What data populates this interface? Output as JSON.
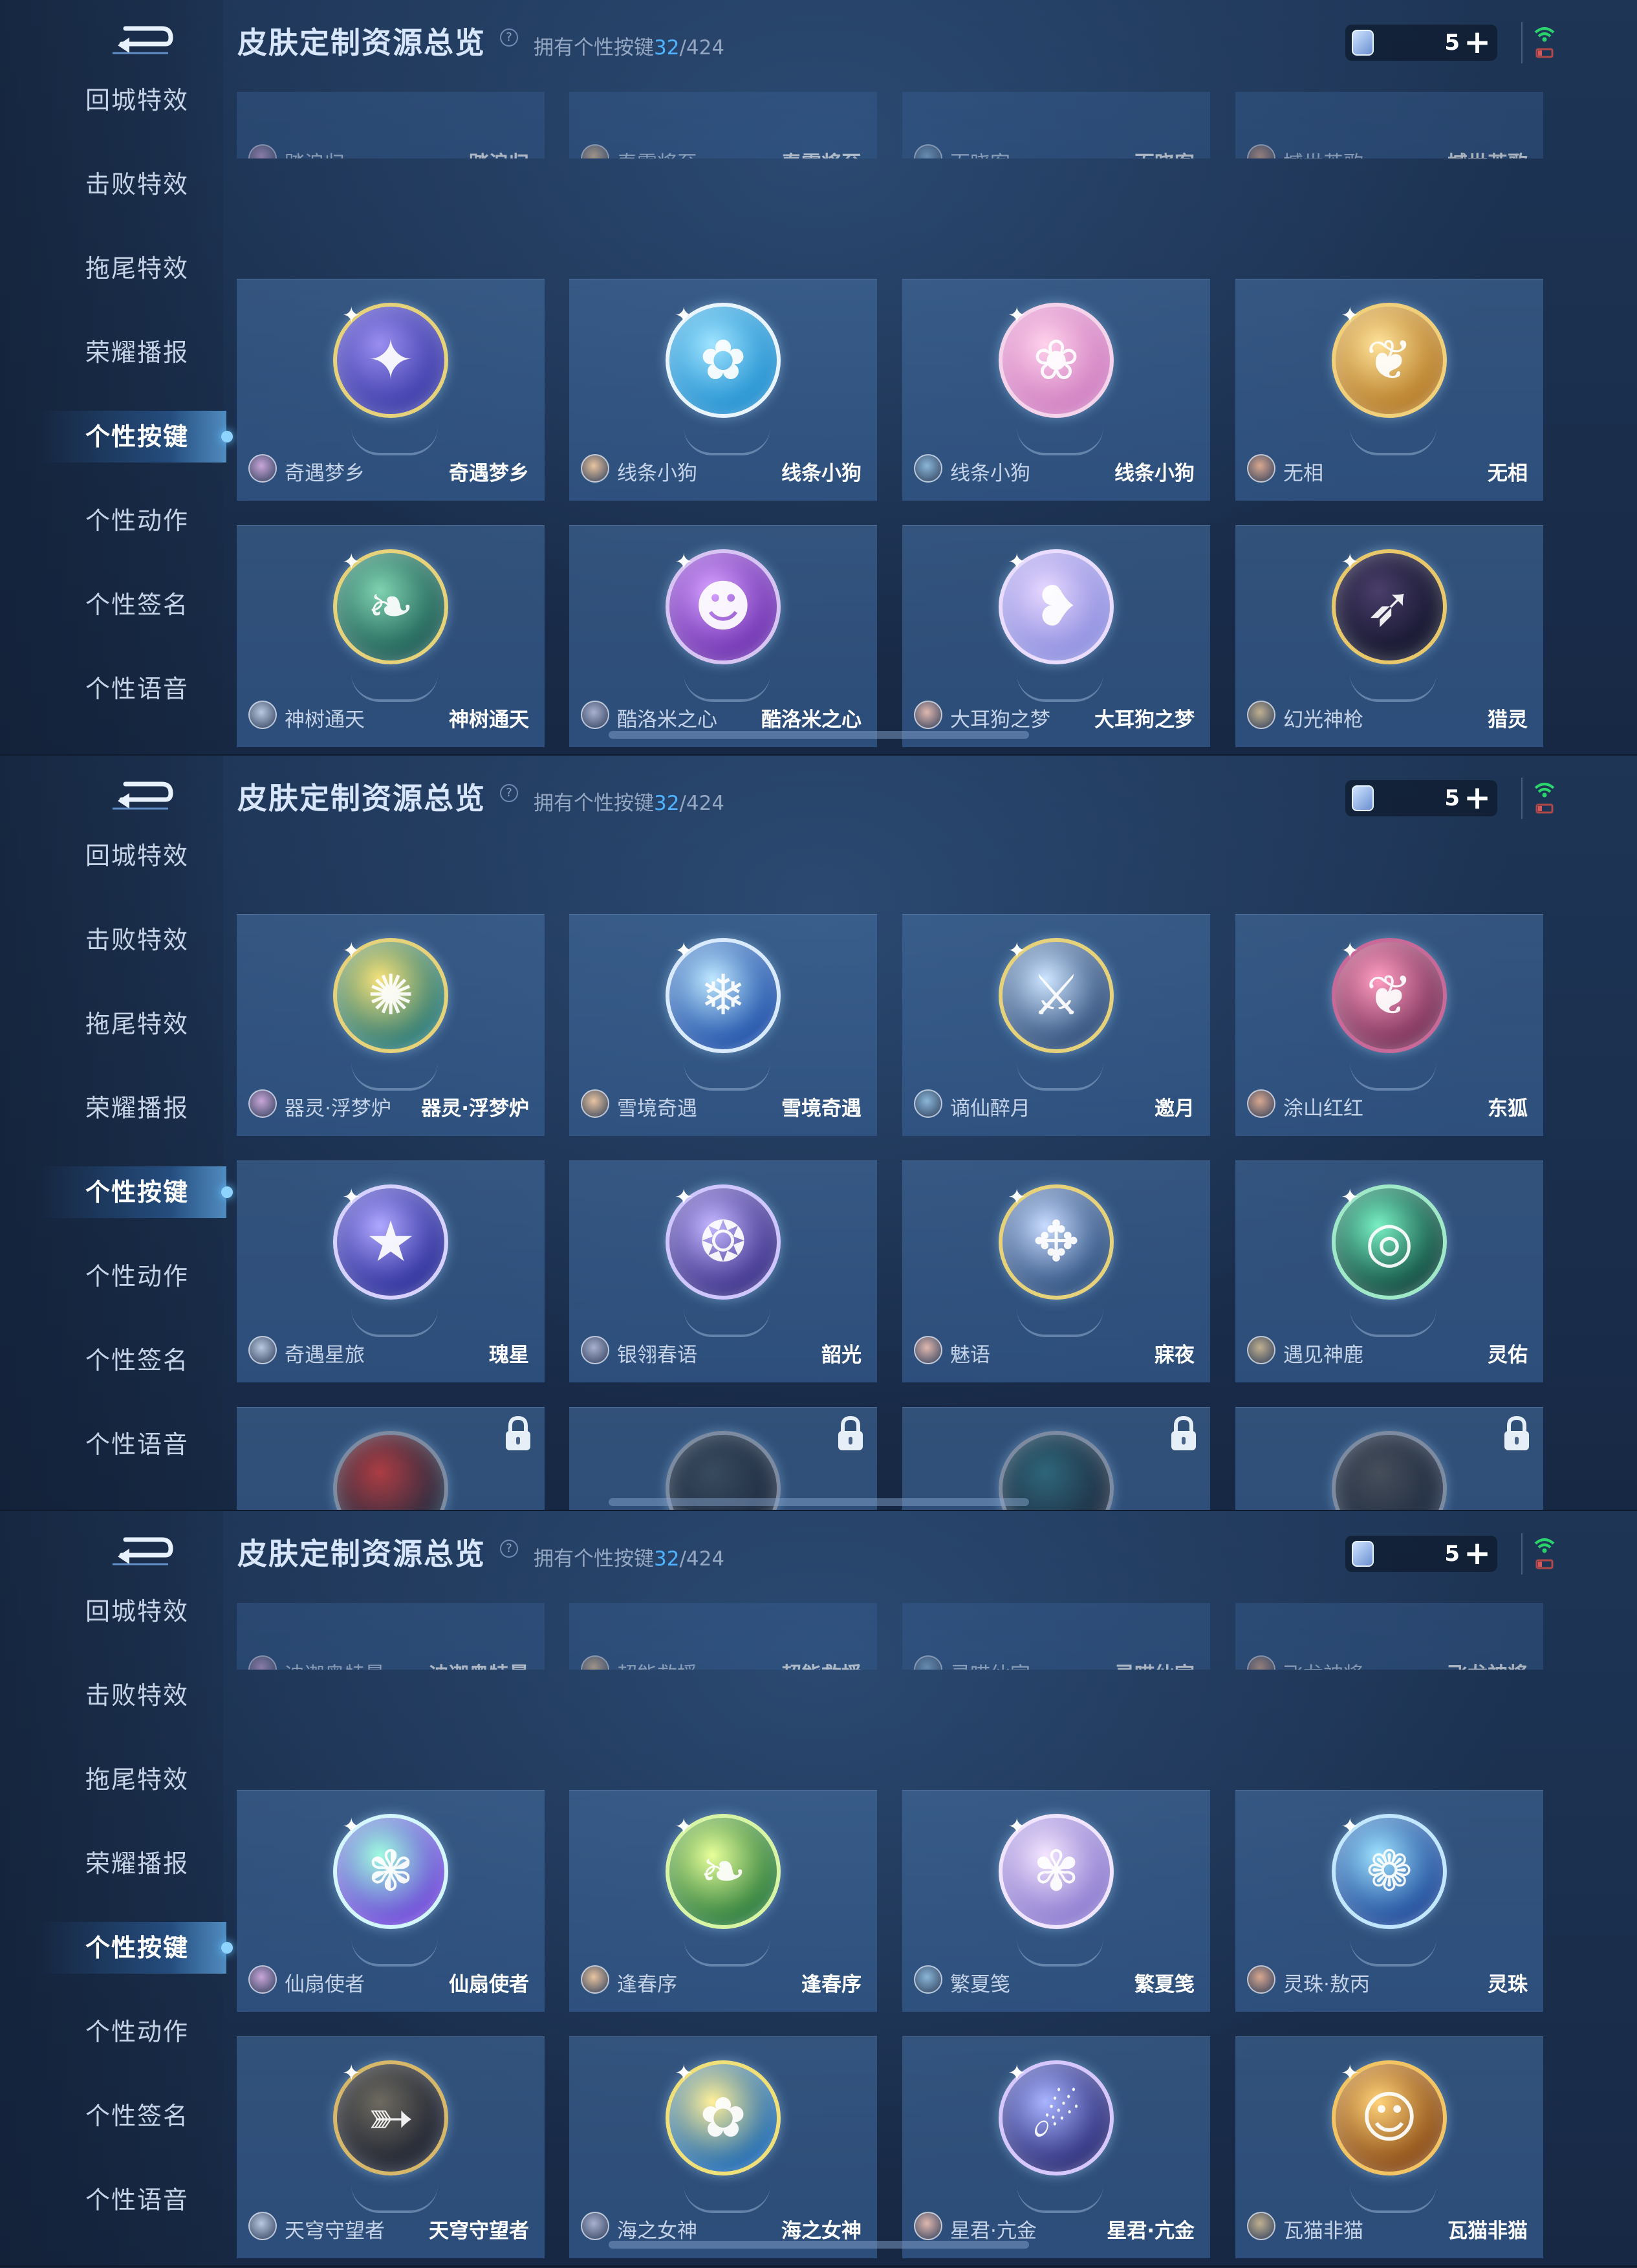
{
  "title": "皮肤定制资源总览",
  "owned_prefix": "拥有个性按键",
  "owned_count": "32",
  "owned_total": "/424",
  "currency_amount": "5",
  "plus_label": "+",
  "help_label": "?",
  "nav": [
    "回城特效",
    "击败特效",
    "拖尾特效",
    "荣耀播报",
    "个性按键",
    "个性动作",
    "个性签名",
    "个性语音"
  ],
  "active_nav_index": 4,
  "colors": {
    "accent": "#4fb4ff",
    "active_nav": "#ffffff",
    "card": "#3a6291",
    "signal": "#2bd56b"
  },
  "icons": {
    "back": "back-arrow-icon",
    "help": "question-icon",
    "currency": "coupon-icon",
    "signal": "wifi-signal-icon",
    "lock": "lock-icon"
  },
  "panels": [
    {
      "partial_row": [
        {
          "hero": "踏浪归",
          "skin": "踏浪归"
        },
        {
          "hero": "春霖将至",
          "skin": "春霖将至"
        },
        {
          "hero": "百晓客",
          "skin": "百晓客"
        },
        {
          "hero": "撼世英歌",
          "skin": "撼世英歌"
        }
      ],
      "rows": [
        [
          {
            "hero": "奇遇梦乡",
            "skin": "奇遇梦乡",
            "icon": "dream-cat-icon"
          },
          {
            "hero": "线条小狗",
            "skin": "线条小狗",
            "icon": "line-puppy-icon"
          },
          {
            "hero": "线条小狗",
            "skin": "线条小狗",
            "icon": "line-puppy-icon"
          },
          {
            "hero": "无相",
            "skin": "无相",
            "icon": "feather-blade-icon"
          }
        ],
        [
          {
            "hero": "神树通天",
            "skin": "神树通天",
            "icon": "golden-leaf-icon"
          },
          {
            "hero": "酷洛米之心",
            "skin": "酷洛米之心",
            "icon": "kuromi-icon"
          },
          {
            "hero": "大耳狗之梦",
            "skin": "大耳狗之梦",
            "icon": "cinnamoroll-icon"
          },
          {
            "hero": "幻光神枪",
            "skin": "猎灵",
            "icon": "spear-icon"
          }
        ]
      ]
    },
    {
      "rows": [
        [
          {
            "hero": "器灵·浮梦炉",
            "skin": "器灵·浮梦炉",
            "icon": "golden-flame-icon"
          },
          {
            "hero": "雪境奇遇",
            "skin": "雪境奇遇",
            "icon": "snowflake-icon"
          },
          {
            "hero": "谪仙醉月",
            "skin": "邀月",
            "icon": "sword-icon"
          },
          {
            "hero": "涂山红红",
            "skin": "东狐",
            "icon": "fox-tail-icon"
          }
        ],
        [
          {
            "hero": "奇遇星旅",
            "skin": "瑰星",
            "icon": "star-wand-icon"
          },
          {
            "hero": "银翎春语",
            "skin": "韶光",
            "icon": "ribbon-orb-icon"
          },
          {
            "hero": "魅语",
            "skin": "寐夜",
            "icon": "fan-icon"
          },
          {
            "hero": "遇见神鹿",
            "skin": "灵佑",
            "icon": "swirl-icon"
          }
        ]
      ],
      "locked_row_count": 4
    },
    {
      "partial_row": [
        {
          "hero": "迪迦奥特曼",
          "skin": "迪迦奥特曼"
        },
        {
          "hero": "超能救援",
          "skin": "超能救援"
        },
        {
          "hero": "灵喵仙官",
          "skin": "灵喵仙官"
        },
        {
          "hero": "飞龙神将",
          "skin": "飞龙神将"
        }
      ],
      "rows": [
        [
          {
            "hero": "仙扇使者",
            "skin": "仙扇使者",
            "icon": "fan-spirit-icon"
          },
          {
            "hero": "逢春序",
            "skin": "逢春序",
            "icon": "green-leaf-icon"
          },
          {
            "hero": "繁夏笺",
            "skin": "繁夏笺",
            "icon": "flower-fairy-icon"
          },
          {
            "hero": "灵珠·敖丙",
            "skin": "灵珠",
            "icon": "ice-flower-icon"
          }
        ],
        [
          {
            "hero": "天穹守望者",
            "skin": "天穹守望者",
            "icon": "golden-bow-icon"
          },
          {
            "hero": "海之女神",
            "skin": "海之女神",
            "icon": "daffodil-icon"
          },
          {
            "hero": "星君·亢金",
            "skin": "星君·亢金",
            "icon": "celestial-icon"
          },
          {
            "hero": "瓦猫非猫",
            "skin": "瓦猫非猫",
            "icon": "tile-cat-icon"
          }
        ]
      ]
    }
  ]
}
